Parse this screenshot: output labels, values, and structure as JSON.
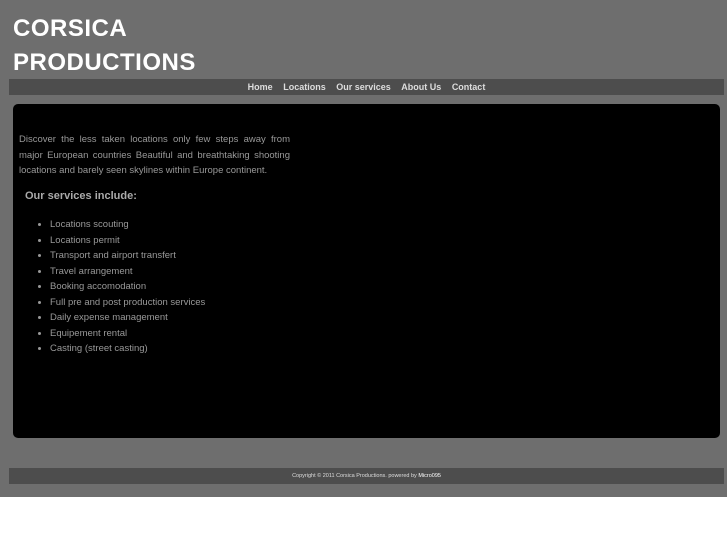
{
  "site": {
    "title_line1": "CORSICA",
    "title_line2": "PRODUCTIONS"
  },
  "nav": {
    "items": [
      "Home",
      "Locations",
      "Our services",
      "About Us",
      "Contact"
    ]
  },
  "main": {
    "intro": "Discover the less taken locations only few steps away from major European countries Beautiful and breathtaking shooting locations and barely seen skylines within Europe continent.",
    "services_heading": "Our services include:",
    "services": [
      "Locations scouting",
      "Locations permit",
      "Transport and airport transfert",
      "Travel arrangement",
      "Booking accomodation",
      "Full pre and post production services",
      "Daily expense management",
      "Equipement rental",
      "Casting (street casting)"
    ]
  },
  "footer": {
    "copyright": "Copyright © 2011 Corsica Productions. powered by",
    "powered_link": "Micro095"
  },
  "colors": {
    "page_background": "#6e6e6e",
    "bar_background": "#4d4d4d",
    "panel_background": "#000000",
    "title_color": "#ffffff",
    "body_text": "#999999"
  }
}
